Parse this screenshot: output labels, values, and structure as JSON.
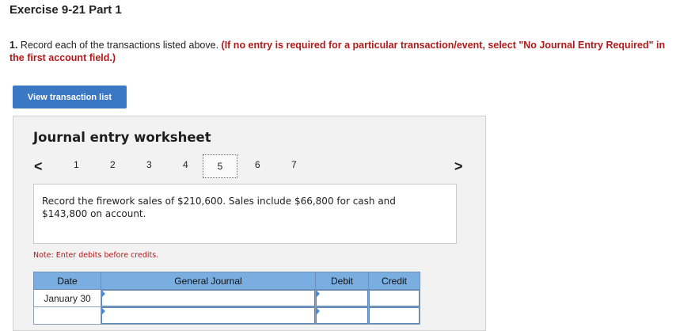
{
  "header": {
    "title": "Exercise 9-21 Part 1"
  },
  "instruction": {
    "number": "1.",
    "text": " Record each of the transactions listed above. ",
    "note": "(If no entry is required for a particular transaction/event, select \"No Journal Entry Required\" in the first account field.)"
  },
  "buttons": {
    "view_transaction_list": "View transaction list"
  },
  "worksheet": {
    "title": "Journal entry worksheet",
    "prev_arrow": "<",
    "next_arrow": ">",
    "pages": [
      "1",
      "2",
      "3",
      "4",
      "5",
      "6",
      "7"
    ],
    "active_page": "5",
    "description": "Record the firework sales of $210,600. Sales include $66,800 for cash and $143,800 on account.",
    "note": "Note: Enter debits before credits.",
    "table": {
      "headers": {
        "date": "Date",
        "general_journal": "General Journal",
        "debit": "Debit",
        "credit": "Credit"
      },
      "rows": [
        {
          "date": "January 30"
        },
        {
          "date": ""
        }
      ]
    }
  },
  "colors": {
    "button_bg": "#3b78c4",
    "header_bg": "#7aaee0",
    "note_red": "#b11a1a",
    "panel_bg": "#f2f2f2"
  }
}
